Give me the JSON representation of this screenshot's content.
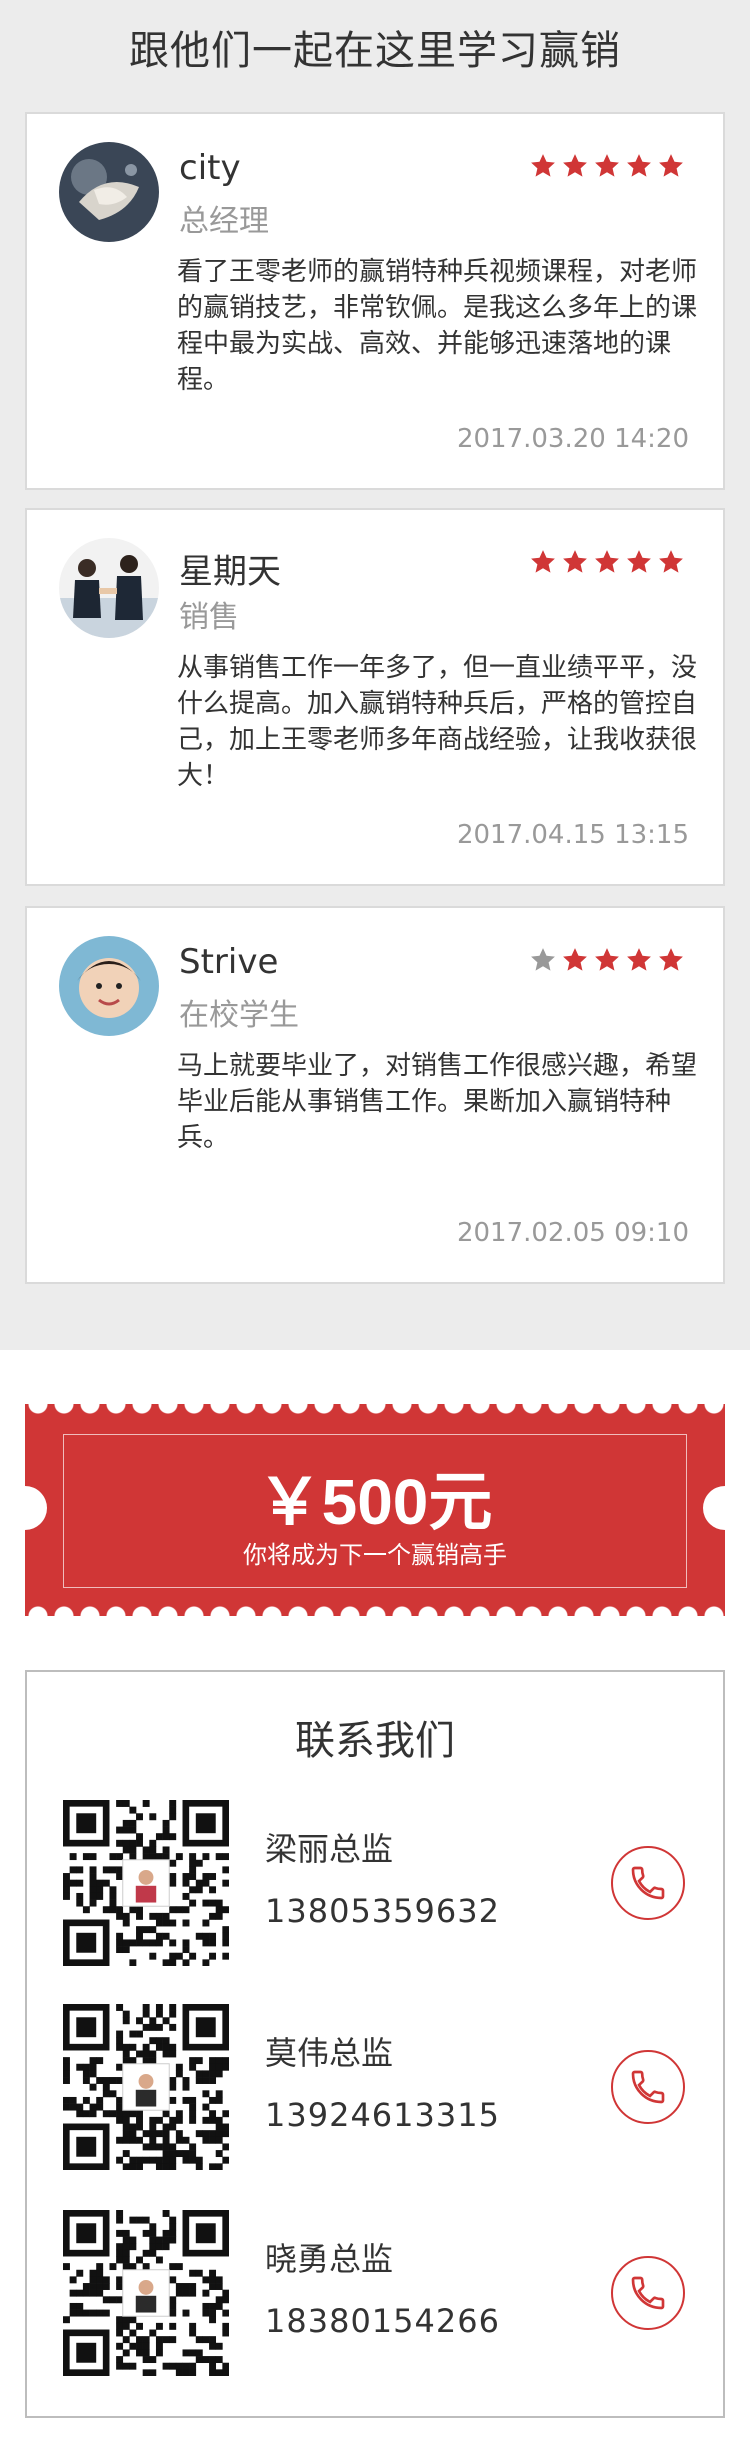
{
  "section_title": "跟他们一起在这里学习赢销",
  "reviews": [
    {
      "name": "city",
      "role": "总经理",
      "rating": 5,
      "comment": "看了王零老师的赢销特种兵视频课程，对老师的赢销技艺，非常钦佩。是我这么多年上的课程中最为实战、高效、并能够迅速落地的课程。",
      "time": "2017.03.20 14:20"
    },
    {
      "name": "星期天",
      "role": "销售",
      "rating": 5,
      "comment": "从事销售工作一年多了，但一直业绩平平，没什么提高。加入赢销特种兵后，严格的管控自己，加上王零老师多年商战经验，让我收获很大！",
      "time": "2017.04.15 13:15"
    },
    {
      "name": "Strive",
      "role": "在校学生",
      "rating": 4,
      "comment": "马上就要毕业了，对销售工作很感兴趣，希望毕业后能从事销售工作。果断加入赢销特种兵。",
      "time": "2017.02.05 09:10"
    }
  ],
  "coupon": {
    "amount": "￥500元",
    "subtitle": "你将成为下一个赢销高手"
  },
  "contact": {
    "title": "联系我们",
    "people": [
      {
        "name": "梁丽总监",
        "phone": "13805359632"
      },
      {
        "name": "莫伟总监",
        "phone": "13924613315"
      },
      {
        "name": "晓勇总监",
        "phone": "18380154266"
      }
    ]
  },
  "colors": {
    "accent": "#d03636",
    "star_active": "#d03636",
    "star_inactive": "#999999",
    "muted_text": "#999999",
    "page_bg": "#ececec"
  },
  "icons": {
    "star": "star-icon",
    "phone": "phone-icon",
    "qr": "qr-code"
  }
}
